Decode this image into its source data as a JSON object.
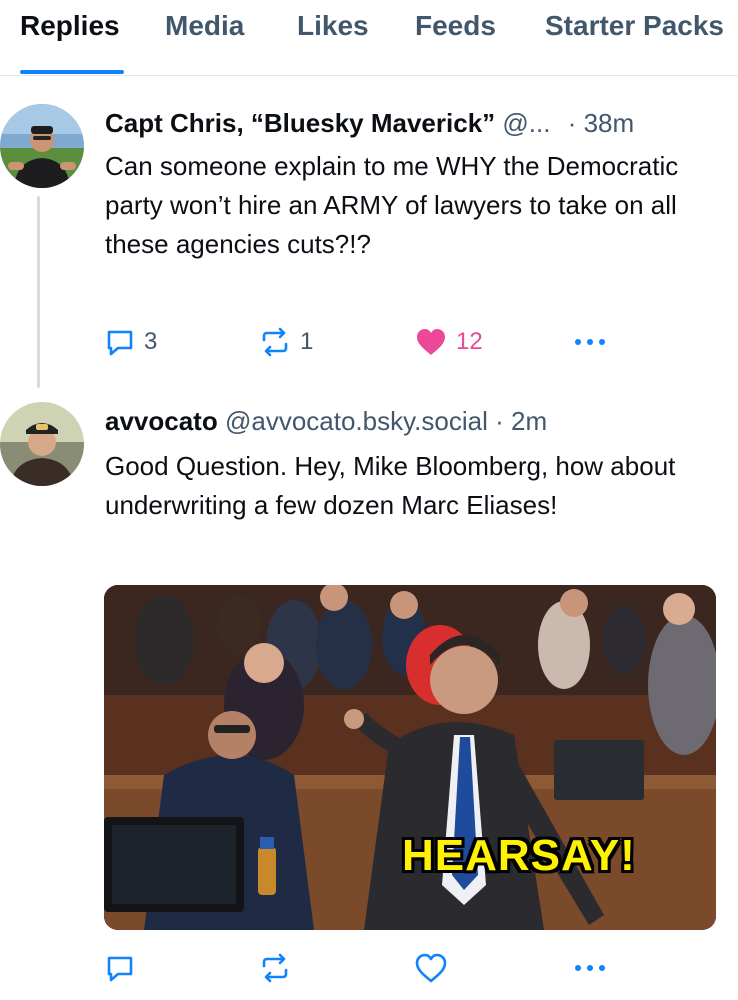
{
  "tabs": [
    {
      "label": "Replies",
      "active": true
    },
    {
      "label": "Media",
      "active": false
    },
    {
      "label": "Likes",
      "active": false
    },
    {
      "label": "Feeds",
      "active": false
    },
    {
      "label": "Starter Packs",
      "active": false
    }
  ],
  "posts": [
    {
      "author": "Capt Chris, “Bluesky Maverick”",
      "handle": "@...",
      "time": "· 38m",
      "text": "Can someone explain to me WHY the Democratic party won’t hire an ARMY of lawyers to take on all these agencies cuts?!?",
      "replies": "3",
      "reposts": "1",
      "likes": "12",
      "liked": true
    },
    {
      "author": "avvocato",
      "handle": "@avvocato.bsky.social",
      "time": "· 2m",
      "text": "Good Question. Hey, Mike Bloomberg, how about underwriting a few dozen Marc Eliases!",
      "embed_caption": "HEARSAY!",
      "liked": false
    }
  ],
  "colors": {
    "accent": "#1083fe",
    "like": "#ec4899",
    "muted": "#42576c"
  },
  "icons": [
    "reply-icon",
    "repost-icon",
    "like-icon",
    "more-icon"
  ]
}
